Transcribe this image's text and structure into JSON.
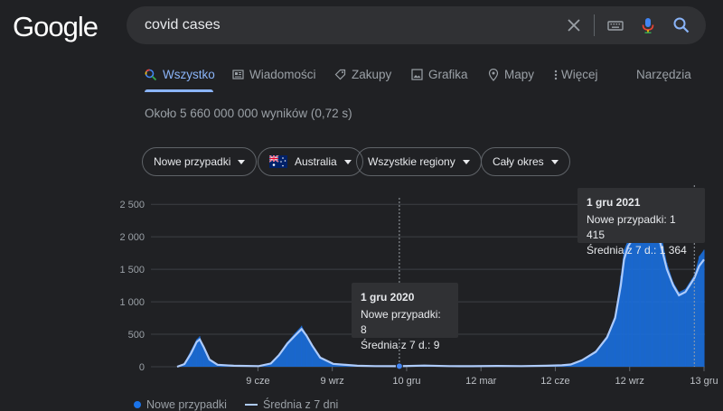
{
  "logo": "Google",
  "search": {
    "value": "covid cases"
  },
  "tabs": [
    {
      "label": "Wszystko",
      "icon": "search-icon"
    },
    {
      "label": "Wiadomości",
      "icon": "news-icon"
    },
    {
      "label": "Zakupy",
      "icon": "tag-icon"
    },
    {
      "label": "Grafika",
      "icon": "image-icon"
    },
    {
      "label": "Mapy",
      "icon": "map-pin-icon"
    },
    {
      "label": "Więcej",
      "icon": "more-vert-icon"
    }
  ],
  "tools_label": "Narzędzia",
  "result_stats": "Około 5 660 000 000 wyników (0,72 s)",
  "filters": {
    "metric": "Nowe przypadki",
    "country": "Australia",
    "region": "Wszystkie regiony",
    "period": "Cały okres"
  },
  "tooltips": {
    "left": {
      "date": "1 gru 2020",
      "new_cases": "Nowe przypadki: 8",
      "avg": "Średnia z 7 d.: 9"
    },
    "right": {
      "date": "1 gru 2021",
      "new_cases": "Nowe przypadki: 1 415",
      "avg": "Średnia z 7 d.: 1 364"
    }
  },
  "legend": {
    "series1": "Nowe przypadki",
    "series2": "Średnia z 7 dni"
  },
  "colors": {
    "accent": "#8ab4f8",
    "bars": "#1a73e8",
    "avg_line": "#aecbfa",
    "background": "#202124"
  },
  "chart_data": {
    "type": "area",
    "y_ticks": [
      "0",
      "500",
      "1 000",
      "1 500",
      "2 000",
      "2 500"
    ],
    "x_ticks": [
      "9 cze",
      "9 wrz",
      "10 gru",
      "12 mar",
      "12 cze",
      "12 wrz",
      "13 gru"
    ],
    "ylim": [
      0,
      2600
    ],
    "grid": true,
    "series": [
      {
        "name": "Nowe przypadki",
        "points": [
          [
            "2020-03-01",
            0
          ],
          [
            "2020-03-10",
            60
          ],
          [
            "2020-03-18",
            250
          ],
          [
            "2020-03-25",
            420
          ],
          [
            "2020-03-29",
            470
          ],
          [
            "2020-04-03",
            300
          ],
          [
            "2020-04-10",
            100
          ],
          [
            "2020-04-20",
            25
          ],
          [
            "2020-05-10",
            15
          ],
          [
            "2020-06-10",
            10
          ],
          [
            "2020-06-25",
            60
          ],
          [
            "2020-07-05",
            200
          ],
          [
            "2020-07-15",
            380
          ],
          [
            "2020-07-25",
            520
          ],
          [
            "2020-08-02",
            630
          ],
          [
            "2020-08-08",
            500
          ],
          [
            "2020-08-15",
            350
          ],
          [
            "2020-08-25",
            150
          ],
          [
            "2020-09-10",
            50
          ],
          [
            "2020-10-10",
            15
          ],
          [
            "2020-11-01",
            10
          ],
          [
            "2020-12-01",
            8
          ],
          [
            "2021-01-01",
            20
          ],
          [
            "2021-02-01",
            10
          ],
          [
            "2021-03-01",
            8
          ],
          [
            "2021-04-01",
            12
          ],
          [
            "2021-05-01",
            10
          ],
          [
            "2021-06-01",
            15
          ],
          [
            "2021-06-20",
            25
          ],
          [
            "2021-07-01",
            40
          ],
          [
            "2021-07-15",
            110
          ],
          [
            "2021-08-01",
            250
          ],
          [
            "2021-08-15",
            480
          ],
          [
            "2021-08-25",
            800
          ],
          [
            "2021-09-01",
            1400
          ],
          [
            "2021-09-05",
            1800
          ],
          [
            "2021-09-10",
            1950
          ],
          [
            "2021-09-15",
            2100
          ],
          [
            "2021-09-25",
            2400
          ],
          [
            "2021-10-01",
            2550
          ],
          [
            "2021-10-10",
            2300
          ],
          [
            "2021-10-20",
            2100
          ],
          [
            "2021-10-28",
            1600
          ],
          [
            "2021-11-05",
            1300
          ],
          [
            "2021-11-12",
            1150
          ],
          [
            "2021-11-20",
            1200
          ],
          [
            "2021-12-01",
            1415
          ],
          [
            "2021-12-07",
            1700
          ],
          [
            "2021-12-13",
            1800
          ]
        ]
      },
      {
        "name": "Średnia z 7 dni",
        "points": [
          [
            "2020-03-01",
            0
          ],
          [
            "2020-03-10",
            40
          ],
          [
            "2020-03-18",
            200
          ],
          [
            "2020-03-25",
            380
          ],
          [
            "2020-03-29",
            420
          ],
          [
            "2020-04-03",
            300
          ],
          [
            "2020-04-10",
            110
          ],
          [
            "2020-04-20",
            30
          ],
          [
            "2020-05-10",
            15
          ],
          [
            "2020-06-10",
            10
          ],
          [
            "2020-06-25",
            50
          ],
          [
            "2020-07-05",
            180
          ],
          [
            "2020-07-15",
            350
          ],
          [
            "2020-07-25",
            480
          ],
          [
            "2020-08-02",
            580
          ],
          [
            "2020-08-08",
            480
          ],
          [
            "2020-08-15",
            330
          ],
          [
            "2020-08-25",
            140
          ],
          [
            "2020-09-10",
            45
          ],
          [
            "2020-10-10",
            15
          ],
          [
            "2020-11-01",
            10
          ],
          [
            "2020-12-01",
            9
          ],
          [
            "2021-01-01",
            18
          ],
          [
            "2021-02-01",
            10
          ],
          [
            "2021-03-01",
            8
          ],
          [
            "2021-04-01",
            12
          ],
          [
            "2021-05-01",
            10
          ],
          [
            "2021-06-01",
            15
          ],
          [
            "2021-06-20",
            22
          ],
          [
            "2021-07-01",
            35
          ],
          [
            "2021-07-15",
            100
          ],
          [
            "2021-08-01",
            230
          ],
          [
            "2021-08-15",
            450
          ],
          [
            "2021-08-25",
            750
          ],
          [
            "2021-09-01",
            1250
          ],
          [
            "2021-09-05",
            1650
          ],
          [
            "2021-09-10",
            1850
          ],
          [
            "2021-09-15",
            1950
          ],
          [
            "2021-09-25",
            2150
          ],
          [
            "2021-10-01",
            2250
          ],
          [
            "2021-10-10",
            2100
          ],
          [
            "2021-10-20",
            1900
          ],
          [
            "2021-10-28",
            1500
          ],
          [
            "2021-11-05",
            1250
          ],
          [
            "2021-11-12",
            1100
          ],
          [
            "2021-11-20",
            1150
          ],
          [
            "2021-12-01",
            1364
          ],
          [
            "2021-12-07",
            1550
          ],
          [
            "2021-12-13",
            1650
          ]
        ]
      }
    ]
  }
}
